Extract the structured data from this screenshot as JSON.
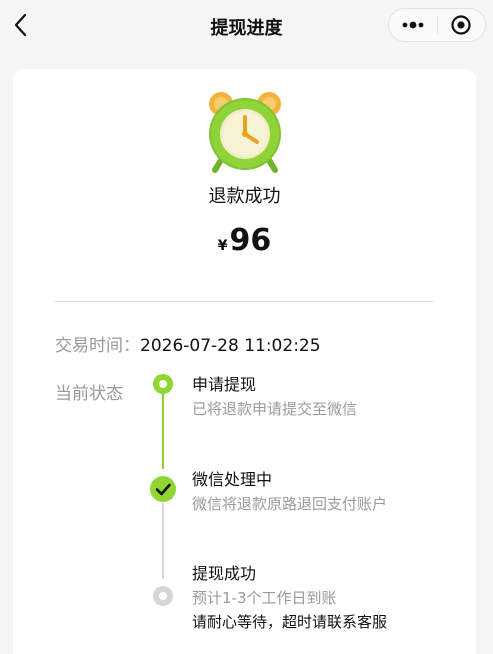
{
  "nav": {
    "title": "提现进度"
  },
  "status": {
    "title": "退款成功",
    "currency": "¥",
    "amount": "96"
  },
  "transaction": {
    "time_label": "交易时间：",
    "time_value": "2026-07-28 11:02:25"
  },
  "current_state_label": "当前状态",
  "timeline": [
    {
      "title": "申请提现",
      "desc": "已将退款申请提交至微信",
      "state": "done"
    },
    {
      "title": "微信处理中",
      "desc": "微信将退款原路退回支付账户",
      "state": "done"
    },
    {
      "title": "提现成功",
      "desc": "预计1-3个工作日到账",
      "note": "请耐心等待，超时请联系客服",
      "state": "pending"
    }
  ],
  "colors": {
    "accent_green": "#91d630",
    "pending_grey": "#d6d6d6",
    "muted_text": "#999999"
  },
  "icons": {
    "back": "chevron-left-icon",
    "more": "more-dots-icon",
    "target": "target-icon",
    "clock": "alarm-clock-icon",
    "check": "check-icon"
  }
}
